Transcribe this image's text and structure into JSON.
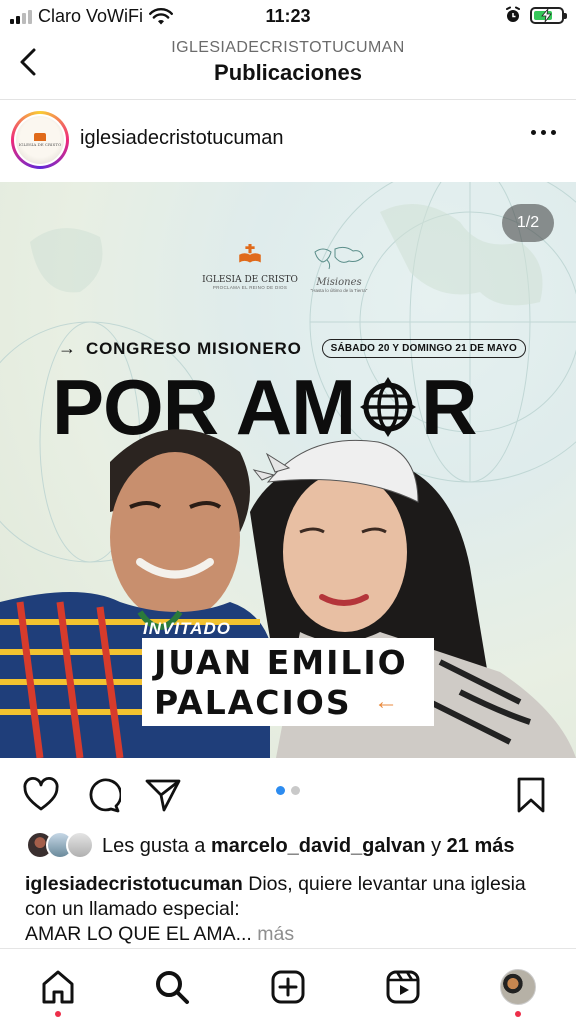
{
  "status_bar": {
    "carrier": "Claro VoWiFi",
    "time": "11:23",
    "icons": [
      "signal-icon",
      "wifi-icon",
      "alarm-icon",
      "battery-charging-icon"
    ]
  },
  "header": {
    "subtitle": "IGLESIADECRISTOTUCUMAN",
    "title": "Publicaciones",
    "back_icon": "chevron-left-icon"
  },
  "post": {
    "username": "iglesiadecristotucuman",
    "image_counter": "1/2",
    "image": {
      "church_name": "IGLESIA DE CRISTO",
      "church_tagline": "PROCLAMA EL REINO DE DIOS",
      "missions_label": "Misiones",
      "missions_tagline": "\"Hasta lo último de la Tierra\"",
      "event_label": "CONGRESO MISIONERO",
      "event_dates": "SÁBADO 20 Y DOMINGO 21 DE MAYO",
      "headline_left": "POR AM",
      "headline_right": "R",
      "guest_label": "INVITADO",
      "guest_name_line1": "JUAN EMILIO",
      "guest_name_line2": "PALACIOS",
      "arrow_left": "←",
      "arrow_right": "→"
    },
    "carousel": {
      "total": 2,
      "current": 1
    },
    "likes": {
      "prefix": "Les gusta a ",
      "user": "marcelo_david_galvan",
      "connector": " y ",
      "others": "21 más"
    },
    "caption": {
      "user": "iglesiadecristotucuman",
      "text": " Dios, quiere levantar una iglesia con un llamado especial:",
      "line2": "AMAR LO QUE EL AMA...",
      "more": " más"
    }
  },
  "colors": {
    "accent_blue": "#2d8cf0",
    "notification_red": "#ed2f4a",
    "arrow_orange": "#e98a3d"
  },
  "bottom_nav": [
    "home-icon",
    "search-icon",
    "new-post-icon",
    "reels-icon",
    "profile-avatar"
  ]
}
